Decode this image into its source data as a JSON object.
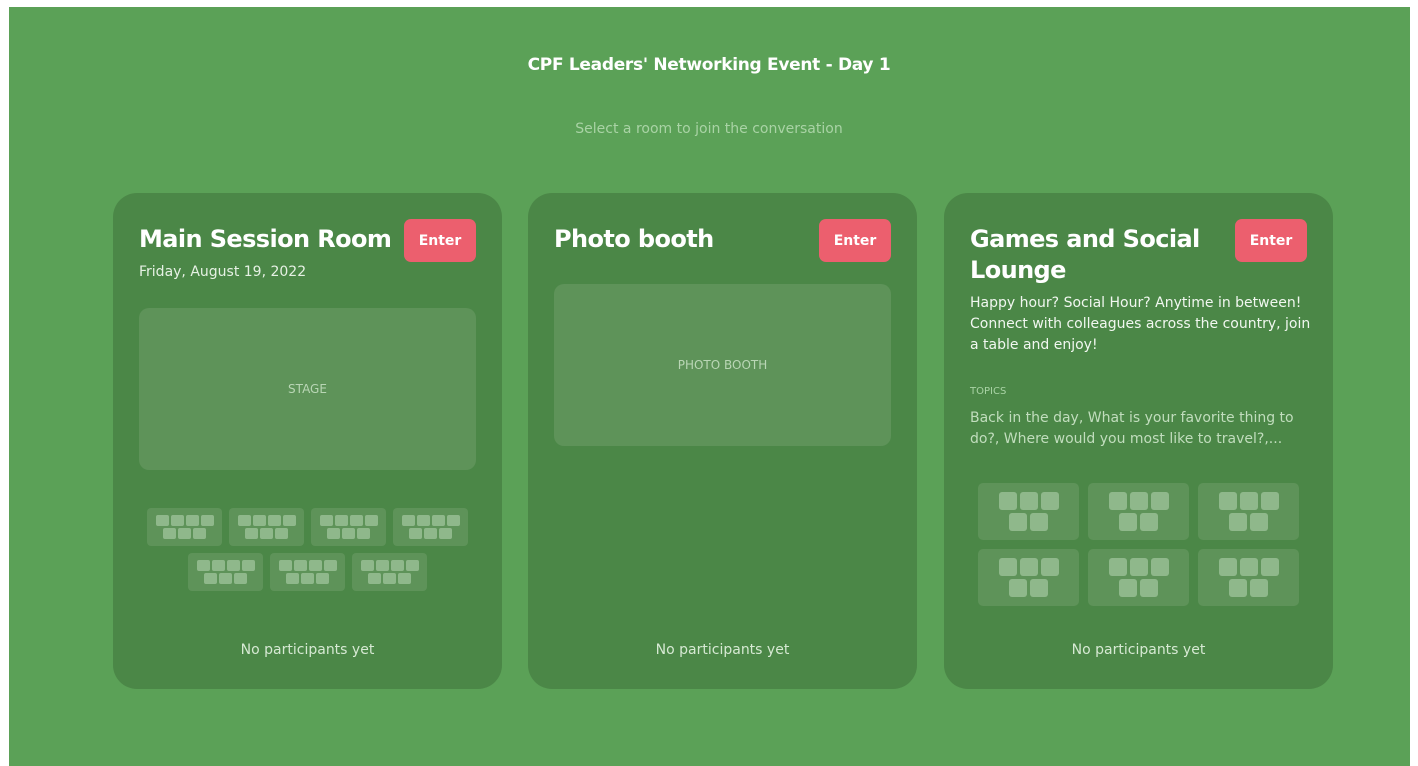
{
  "event": {
    "title": "CPF Leaders' Networking Event - Day 1",
    "subtitle": "Select a room to join the conversation"
  },
  "rooms": [
    {
      "title": "Main Session Room",
      "date": "Friday, August 19, 2022",
      "enter_label": "Enter",
      "stage_label": "STAGE",
      "table_count": 7,
      "empty_label": "No participants yet"
    },
    {
      "title": "Photo booth",
      "enter_label": "Enter",
      "stage_label": "PHOTO BOOTH",
      "empty_label": "No participants yet"
    },
    {
      "title": "Games and Social Lounge",
      "enter_label": "Enter",
      "description": "Happy hour? Social Hour? Anytime in between! Connect with colleagues across the country, join a table and enjoy!",
      "topics_label": "TOPICS",
      "topics": "Back in the day, What is your favorite thing to do?, Where would you most like to travel?,...",
      "table_count": 6,
      "empty_label": "No participants yet"
    }
  ],
  "colors": {
    "background": "#5ba157",
    "card": "#4b8747",
    "accent": "#ec5f6e",
    "table": "#5e9359",
    "seat": "#8fb88b"
  }
}
